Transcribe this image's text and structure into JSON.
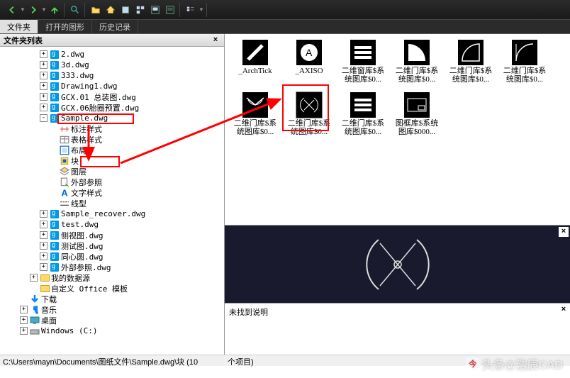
{
  "toolbar_icons": [
    "back",
    "forward",
    "up",
    "search",
    "folder",
    "home",
    "fav",
    "tree",
    "preview",
    "desc",
    "list"
  ],
  "tabs": [
    "文件夹",
    "打开的图形",
    "历史记录"
  ],
  "sidebar": {
    "title": "文件夹列表"
  },
  "tree": [
    {
      "indent": 2,
      "toggle": "+",
      "icon": "dwg",
      "label": "2.dwg"
    },
    {
      "indent": 2,
      "toggle": "+",
      "icon": "dwg",
      "label": "3d.dwg"
    },
    {
      "indent": 2,
      "toggle": "+",
      "icon": "dwg",
      "label": "333.dwg"
    },
    {
      "indent": 2,
      "toggle": "+",
      "icon": "dwg",
      "label": "Drawing1.dwg"
    },
    {
      "indent": 2,
      "toggle": "+",
      "icon": "dwg",
      "label": "GCX.01 总装图.dwg"
    },
    {
      "indent": 2,
      "toggle": "+",
      "icon": "dwg",
      "label": "GCX.06胎圈预置.dwg"
    },
    {
      "indent": 2,
      "toggle": "-",
      "icon": "dwg",
      "label": "Sample.dwg",
      "hl": true
    },
    {
      "indent": 3,
      "icon": "dim",
      "label": "标注样式"
    },
    {
      "indent": 3,
      "icon": "table",
      "label": "表格样式"
    },
    {
      "indent": 3,
      "icon": "layout",
      "label": "布局"
    },
    {
      "indent": 3,
      "icon": "block",
      "label": "块",
      "hl": true
    },
    {
      "indent": 3,
      "icon": "layer",
      "label": "图层"
    },
    {
      "indent": 3,
      "icon": "xref",
      "label": "外部参照"
    },
    {
      "indent": 3,
      "icon": "text",
      "label": "文字样式"
    },
    {
      "indent": 3,
      "icon": "line",
      "label": "线型"
    },
    {
      "indent": 2,
      "toggle": "+",
      "icon": "dwg",
      "label": "Sample_recover.dwg"
    },
    {
      "indent": 2,
      "toggle": "+",
      "icon": "dwg",
      "label": "test.dwg"
    },
    {
      "indent": 2,
      "toggle": "+",
      "icon": "dwg",
      "label": "侧视图.dwg"
    },
    {
      "indent": 2,
      "toggle": "+",
      "icon": "dwg",
      "label": "测试图.dwg"
    },
    {
      "indent": 2,
      "toggle": "+",
      "icon": "dwg",
      "label": "同心圆.dwg"
    },
    {
      "indent": 2,
      "toggle": "+",
      "icon": "dwg",
      "label": "外部参照.dwg"
    },
    {
      "indent": 1,
      "toggle": "+",
      "icon": "folder",
      "label": "我的数据源"
    },
    {
      "indent": 1,
      "icon": "folder",
      "label": "自定义 Office 模板"
    },
    {
      "indent": 0,
      "icon": "dl",
      "label": "下载"
    },
    {
      "indent": 0,
      "toggle": "+",
      "icon": "music",
      "label": "音乐"
    },
    {
      "indent": 0,
      "toggle": "+",
      "icon": "desktop",
      "label": "桌面"
    },
    {
      "indent": 0,
      "toggle": "+",
      "icon": "drive",
      "label": "Windows (C:)"
    }
  ],
  "grid_items": [
    {
      "label": "_ArchTick",
      "svg": "tick"
    },
    {
      "label": "_AXISO",
      "svg": "axiso"
    },
    {
      "label": "二维窗库$系统图库$0...",
      "svg": "hbars"
    },
    {
      "label": "二维门库$系统图库$0...",
      "svg": "arc1"
    },
    {
      "label": "二维门库$系统图库$0...",
      "svg": "arc2"
    },
    {
      "label": "二维门库$系统图库$0...",
      "svg": "arc3"
    },
    {
      "label": "二维门库$系统图库$0...",
      "svg": "door1"
    },
    {
      "label": "二维门库$系统图库$0...",
      "svg": "circ",
      "selected": true
    },
    {
      "label": "二维门库$系统图库$0...",
      "svg": "hbars"
    },
    {
      "label": "图框库$系统图库$000...",
      "svg": "frame"
    }
  ],
  "description": "未找到说明",
  "status_left": "C:\\Users\\mayn\\Documents\\图纸文件\\Sample.dwg\\块 (10",
  "status_right": "个项目)",
  "watermark": "头条@浩辰CAD"
}
